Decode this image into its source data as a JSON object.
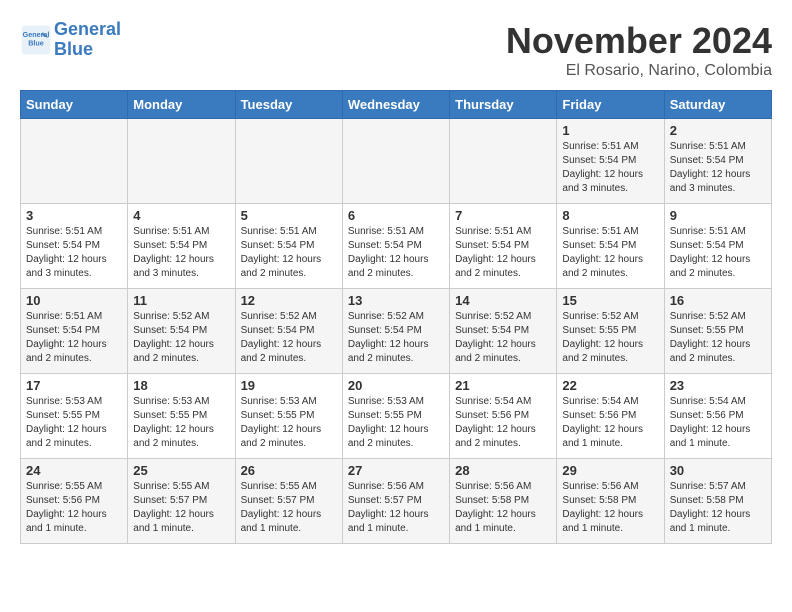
{
  "logo": {
    "line1": "General",
    "line2": "Blue"
  },
  "title": "November 2024",
  "location": "El Rosario, Narino, Colombia",
  "header": {
    "days": [
      "Sunday",
      "Monday",
      "Tuesday",
      "Wednesday",
      "Thursday",
      "Friday",
      "Saturday"
    ]
  },
  "weeks": [
    [
      {
        "day": "",
        "info": ""
      },
      {
        "day": "",
        "info": ""
      },
      {
        "day": "",
        "info": ""
      },
      {
        "day": "",
        "info": ""
      },
      {
        "day": "",
        "info": ""
      },
      {
        "day": "1",
        "info": "Sunrise: 5:51 AM\nSunset: 5:54 PM\nDaylight: 12 hours and 3 minutes."
      },
      {
        "day": "2",
        "info": "Sunrise: 5:51 AM\nSunset: 5:54 PM\nDaylight: 12 hours and 3 minutes."
      }
    ],
    [
      {
        "day": "3",
        "info": "Sunrise: 5:51 AM\nSunset: 5:54 PM\nDaylight: 12 hours and 3 minutes."
      },
      {
        "day": "4",
        "info": "Sunrise: 5:51 AM\nSunset: 5:54 PM\nDaylight: 12 hours and 3 minutes."
      },
      {
        "day": "5",
        "info": "Sunrise: 5:51 AM\nSunset: 5:54 PM\nDaylight: 12 hours and 2 minutes."
      },
      {
        "day": "6",
        "info": "Sunrise: 5:51 AM\nSunset: 5:54 PM\nDaylight: 12 hours and 2 minutes."
      },
      {
        "day": "7",
        "info": "Sunrise: 5:51 AM\nSunset: 5:54 PM\nDaylight: 12 hours and 2 minutes."
      },
      {
        "day": "8",
        "info": "Sunrise: 5:51 AM\nSunset: 5:54 PM\nDaylight: 12 hours and 2 minutes."
      },
      {
        "day": "9",
        "info": "Sunrise: 5:51 AM\nSunset: 5:54 PM\nDaylight: 12 hours and 2 minutes."
      }
    ],
    [
      {
        "day": "10",
        "info": "Sunrise: 5:51 AM\nSunset: 5:54 PM\nDaylight: 12 hours and 2 minutes."
      },
      {
        "day": "11",
        "info": "Sunrise: 5:52 AM\nSunset: 5:54 PM\nDaylight: 12 hours and 2 minutes."
      },
      {
        "day": "12",
        "info": "Sunrise: 5:52 AM\nSunset: 5:54 PM\nDaylight: 12 hours and 2 minutes."
      },
      {
        "day": "13",
        "info": "Sunrise: 5:52 AM\nSunset: 5:54 PM\nDaylight: 12 hours and 2 minutes."
      },
      {
        "day": "14",
        "info": "Sunrise: 5:52 AM\nSunset: 5:54 PM\nDaylight: 12 hours and 2 minutes."
      },
      {
        "day": "15",
        "info": "Sunrise: 5:52 AM\nSunset: 5:55 PM\nDaylight: 12 hours and 2 minutes."
      },
      {
        "day": "16",
        "info": "Sunrise: 5:52 AM\nSunset: 5:55 PM\nDaylight: 12 hours and 2 minutes."
      }
    ],
    [
      {
        "day": "17",
        "info": "Sunrise: 5:53 AM\nSunset: 5:55 PM\nDaylight: 12 hours and 2 minutes."
      },
      {
        "day": "18",
        "info": "Sunrise: 5:53 AM\nSunset: 5:55 PM\nDaylight: 12 hours and 2 minutes."
      },
      {
        "day": "19",
        "info": "Sunrise: 5:53 AM\nSunset: 5:55 PM\nDaylight: 12 hours and 2 minutes."
      },
      {
        "day": "20",
        "info": "Sunrise: 5:53 AM\nSunset: 5:55 PM\nDaylight: 12 hours and 2 minutes."
      },
      {
        "day": "21",
        "info": "Sunrise: 5:54 AM\nSunset: 5:56 PM\nDaylight: 12 hours and 2 minutes."
      },
      {
        "day": "22",
        "info": "Sunrise: 5:54 AM\nSunset: 5:56 PM\nDaylight: 12 hours and 1 minute."
      },
      {
        "day": "23",
        "info": "Sunrise: 5:54 AM\nSunset: 5:56 PM\nDaylight: 12 hours and 1 minute."
      }
    ],
    [
      {
        "day": "24",
        "info": "Sunrise: 5:55 AM\nSunset: 5:56 PM\nDaylight: 12 hours and 1 minute."
      },
      {
        "day": "25",
        "info": "Sunrise: 5:55 AM\nSunset: 5:57 PM\nDaylight: 12 hours and 1 minute."
      },
      {
        "day": "26",
        "info": "Sunrise: 5:55 AM\nSunset: 5:57 PM\nDaylight: 12 hours and 1 minute."
      },
      {
        "day": "27",
        "info": "Sunrise: 5:56 AM\nSunset: 5:57 PM\nDaylight: 12 hours and 1 minute."
      },
      {
        "day": "28",
        "info": "Sunrise: 5:56 AM\nSunset: 5:58 PM\nDaylight: 12 hours and 1 minute."
      },
      {
        "day": "29",
        "info": "Sunrise: 5:56 AM\nSunset: 5:58 PM\nDaylight: 12 hours and 1 minute."
      },
      {
        "day": "30",
        "info": "Sunrise: 5:57 AM\nSunset: 5:58 PM\nDaylight: 12 hours and 1 minute."
      }
    ]
  ]
}
